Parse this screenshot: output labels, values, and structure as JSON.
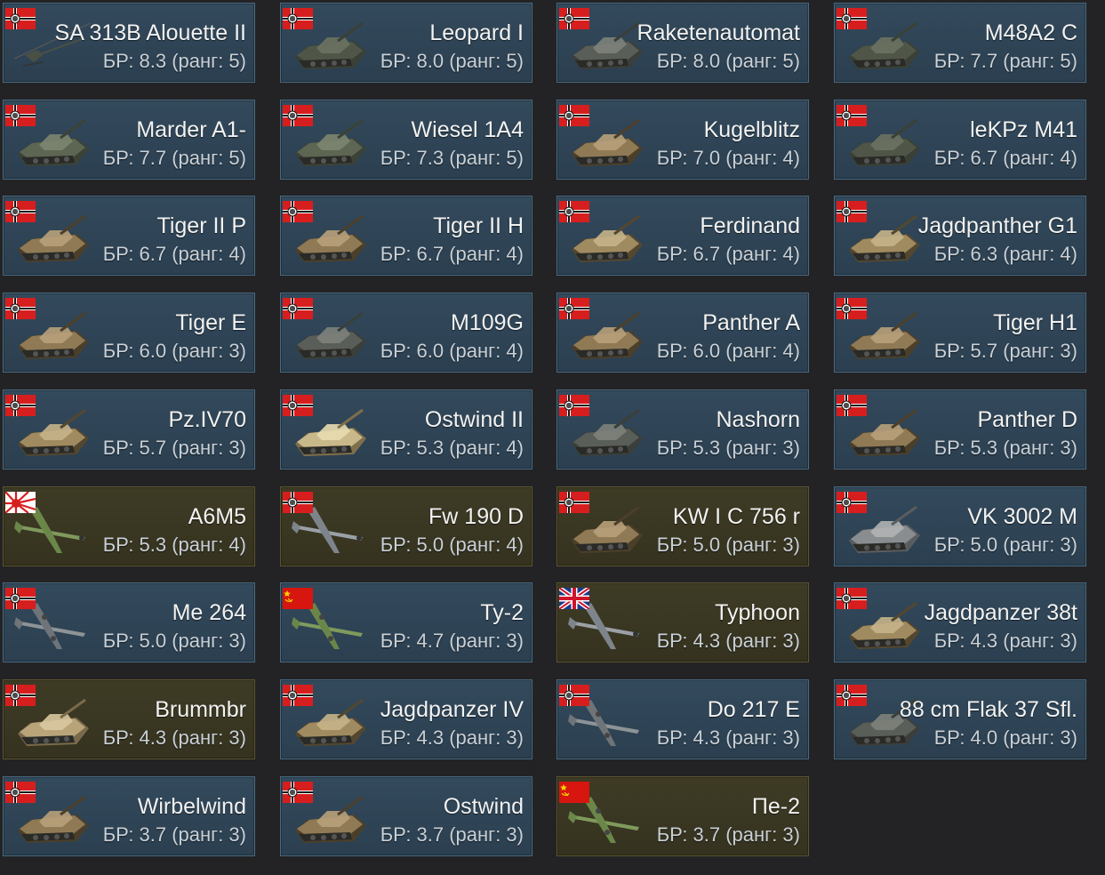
{
  "vehicles": [
    {
      "name": "SA 313B Alouette II",
      "br": "БР: 8.3 (ранг: 5)",
      "flag": "germany-flag-icon",
      "type": "heli",
      "premium": false
    },
    {
      "name": "Leopard I",
      "br": "БР: 8.0 (ранг: 5)",
      "flag": "germany-flag-icon",
      "type": "tank",
      "premium": false
    },
    {
      "name": "Raketenautomat",
      "br": "БР: 8.0 (ранг: 5)",
      "flag": "germany-flag-icon",
      "type": "spg",
      "premium": false
    },
    {
      "name": "M48A2 C",
      "br": "БР: 7.7 (ранг: 5)",
      "flag": "germany-flag-icon",
      "type": "tank",
      "premium": false
    },
    {
      "name": "Marder A1-",
      "br": "БР: 7.7 (ранг: 5)",
      "flag": "germany-flag-icon",
      "type": "ifv",
      "premium": false
    },
    {
      "name": "Wiesel 1A4",
      "br": "БР: 7.3 (ранг: 5)",
      "flag": "germany-flag-icon",
      "type": "ifv",
      "premium": false
    },
    {
      "name": "Kugelblitz",
      "br": "БР: 7.0 (ранг: 4)",
      "flag": "germany-flag-icon",
      "type": "tank-camo",
      "premium": false
    },
    {
      "name": "leKPz M41",
      "br": "БР: 6.7 (ранг: 4)",
      "flag": "germany-flag-icon",
      "type": "tank",
      "premium": false
    },
    {
      "name": "Tiger II P",
      "br": "БР: 6.7 (ранг: 4)",
      "flag": "germany-flag-icon",
      "type": "tank-camo",
      "premium": false
    },
    {
      "name": "Tiger II H",
      "br": "БР: 6.7 (ранг: 4)",
      "flag": "germany-flag-icon",
      "type": "tank-camo",
      "premium": false
    },
    {
      "name": "Ferdinand",
      "br": "БР: 6.7 (ранг: 4)",
      "flag": "germany-flag-icon",
      "type": "spg-camo",
      "premium": false
    },
    {
      "name": "Jagdpanther G1",
      "br": "БР: 6.3 (ранг: 4)",
      "flag": "germany-flag-icon",
      "type": "spg-camo",
      "premium": false
    },
    {
      "name": "Tiger E",
      "br": "БР: 6.0 (ранг: 3)",
      "flag": "germany-flag-icon",
      "type": "tank-camo",
      "premium": false
    },
    {
      "name": "M109G",
      "br": "БР: 6.0 (ранг: 4)",
      "flag": "germany-flag-icon",
      "type": "spg",
      "premium": false
    },
    {
      "name": "Panther A",
      "br": "БР: 6.0 (ранг: 4)",
      "flag": "germany-flag-icon",
      "type": "tank-camo",
      "premium": false
    },
    {
      "name": "Tiger H1",
      "br": "БР: 5.7 (ранг: 3)",
      "flag": "germany-flag-icon",
      "type": "tank-camo",
      "premium": false
    },
    {
      "name": "Pz.IV70",
      "br": "БР: 5.7 (ранг: 3)",
      "flag": "germany-flag-icon",
      "type": "spg-camo",
      "premium": false
    },
    {
      "name": "Ostwind II",
      "br": "БР: 5.3 (ранг: 4)",
      "flag": "germany-flag-icon",
      "type": "aa-tan",
      "premium": false
    },
    {
      "name": "Nashorn",
      "br": "БР: 5.3 (ранг: 3)",
      "flag": "germany-flag-icon",
      "type": "spg",
      "premium": false
    },
    {
      "name": "Panther D",
      "br": "БР: 5.3 (ранг: 3)",
      "flag": "germany-flag-icon",
      "type": "tank-camo",
      "premium": false
    },
    {
      "name": "A6M5",
      "br": "БР: 5.3 (ранг: 4)",
      "flag": "japan-flag-icon",
      "type": "plane-green",
      "premium": true
    },
    {
      "name": "Fw 190 D",
      "br": "БР: 5.0 (ранг: 4)",
      "flag": "germany-flag-icon",
      "type": "plane-grey",
      "premium": true
    },
    {
      "name": "KW I C 756 r",
      "br": "БР: 5.0 (ранг: 3)",
      "flag": "germany-flag-icon",
      "type": "tank-camo",
      "premium": true
    },
    {
      "name": "VK 3002 M",
      "br": "БР: 5.0 (ранг: 3)",
      "flag": "germany-flag-icon",
      "type": "tank-grey",
      "premium": false
    },
    {
      "name": "Me 264",
      "br": "БР: 5.0 (ранг: 3)",
      "flag": "germany-flag-icon",
      "type": "bomber-grey",
      "premium": false
    },
    {
      "name": "Ту-2",
      "br": "БР: 4.7 (ранг: 3)",
      "flag": "ussr-flag-icon",
      "type": "bomber-green",
      "premium": false
    },
    {
      "name": "Typhoon",
      "br": "БР: 4.3 (ранг: 3)",
      "flag": "uk-flag-icon",
      "type": "plane-grey",
      "premium": true
    },
    {
      "name": "Jagdpanzer 38t",
      "br": "БР: 4.3 (ранг: 3)",
      "flag": "germany-flag-icon",
      "type": "spg-camo",
      "premium": false
    },
    {
      "name": "Brummbr",
      "br": "БР: 4.3 (ранг: 3)",
      "flag": "germany-flag-icon",
      "type": "spg-tan",
      "premium": true
    },
    {
      "name": "Jagdpanzer IV",
      "br": "БР: 4.3 (ранг: 3)",
      "flag": "germany-flag-icon",
      "type": "spg-camo",
      "premium": false
    },
    {
      "name": "Do 217 E",
      "br": "БР: 4.3 (ранг: 3)",
      "flag": "germany-flag-icon",
      "type": "bomber-grey",
      "premium": false
    },
    {
      "name": "88 cm Flak 37 Sfl.",
      "br": "БР: 4.0 (ранг: 3)",
      "flag": "germany-flag-icon",
      "type": "spg",
      "premium": false
    },
    {
      "name": "Wirbelwind",
      "br": "БР: 3.7 (ранг: 3)",
      "flag": "germany-flag-icon",
      "type": "tank-camo",
      "premium": false
    },
    {
      "name": "Ostwind",
      "br": "БР: 3.7 (ранг: 3)",
      "flag": "germany-flag-icon",
      "type": "tank-camo",
      "premium": false
    },
    {
      "name": "Пе-2",
      "br": "БР: 3.7 (ранг: 3)",
      "flag": "ussr-flag-icon",
      "type": "bomber-green",
      "premium": true
    }
  ]
}
